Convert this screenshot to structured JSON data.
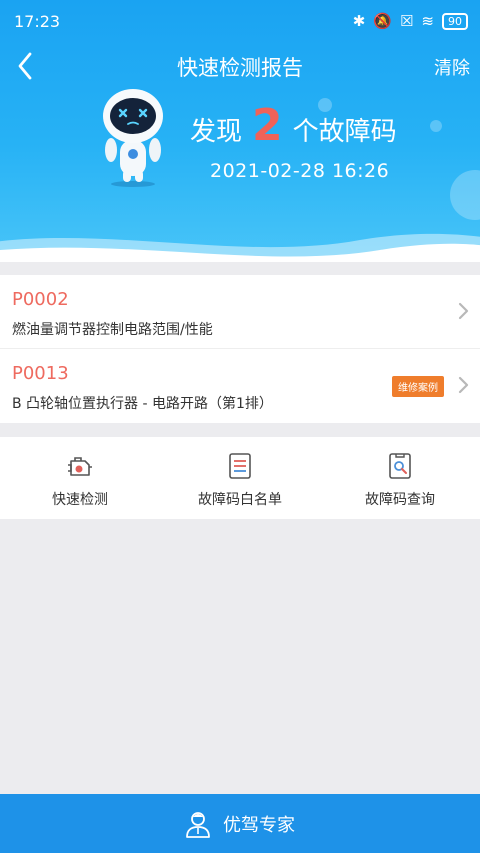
{
  "status_bar": {
    "time": "17:23",
    "battery": "90"
  },
  "header": {
    "title": "快速检测报告",
    "clear_label": "清除",
    "found_prefix": "发现",
    "found_count": "2",
    "found_suffix": "个故障码",
    "datetime": "2021-02-28 16:26"
  },
  "fault_codes": [
    {
      "code": "P0002",
      "description": "燃油量调节器控制电路范围/性能",
      "badge": ""
    },
    {
      "code": "P0013",
      "description": "B 凸轮轴位置执行器 - 电路开路（第1排）",
      "badge": "维修案例"
    }
  ],
  "tools": [
    {
      "label": "快速检测",
      "icon": "engine-icon"
    },
    {
      "label": "故障码白名单",
      "icon": "list-document-icon"
    },
    {
      "label": "故障码查询",
      "icon": "search-document-icon"
    }
  ],
  "bottom_bar": {
    "label": "优驾专家",
    "icon": "expert-avatar-icon"
  },
  "colors": {
    "header_blue": "#1aa3f2",
    "fault_code_red": "#ee6a5f",
    "badge_orange": "#ef7d2c",
    "bottom_blue": "#1e92e8"
  }
}
